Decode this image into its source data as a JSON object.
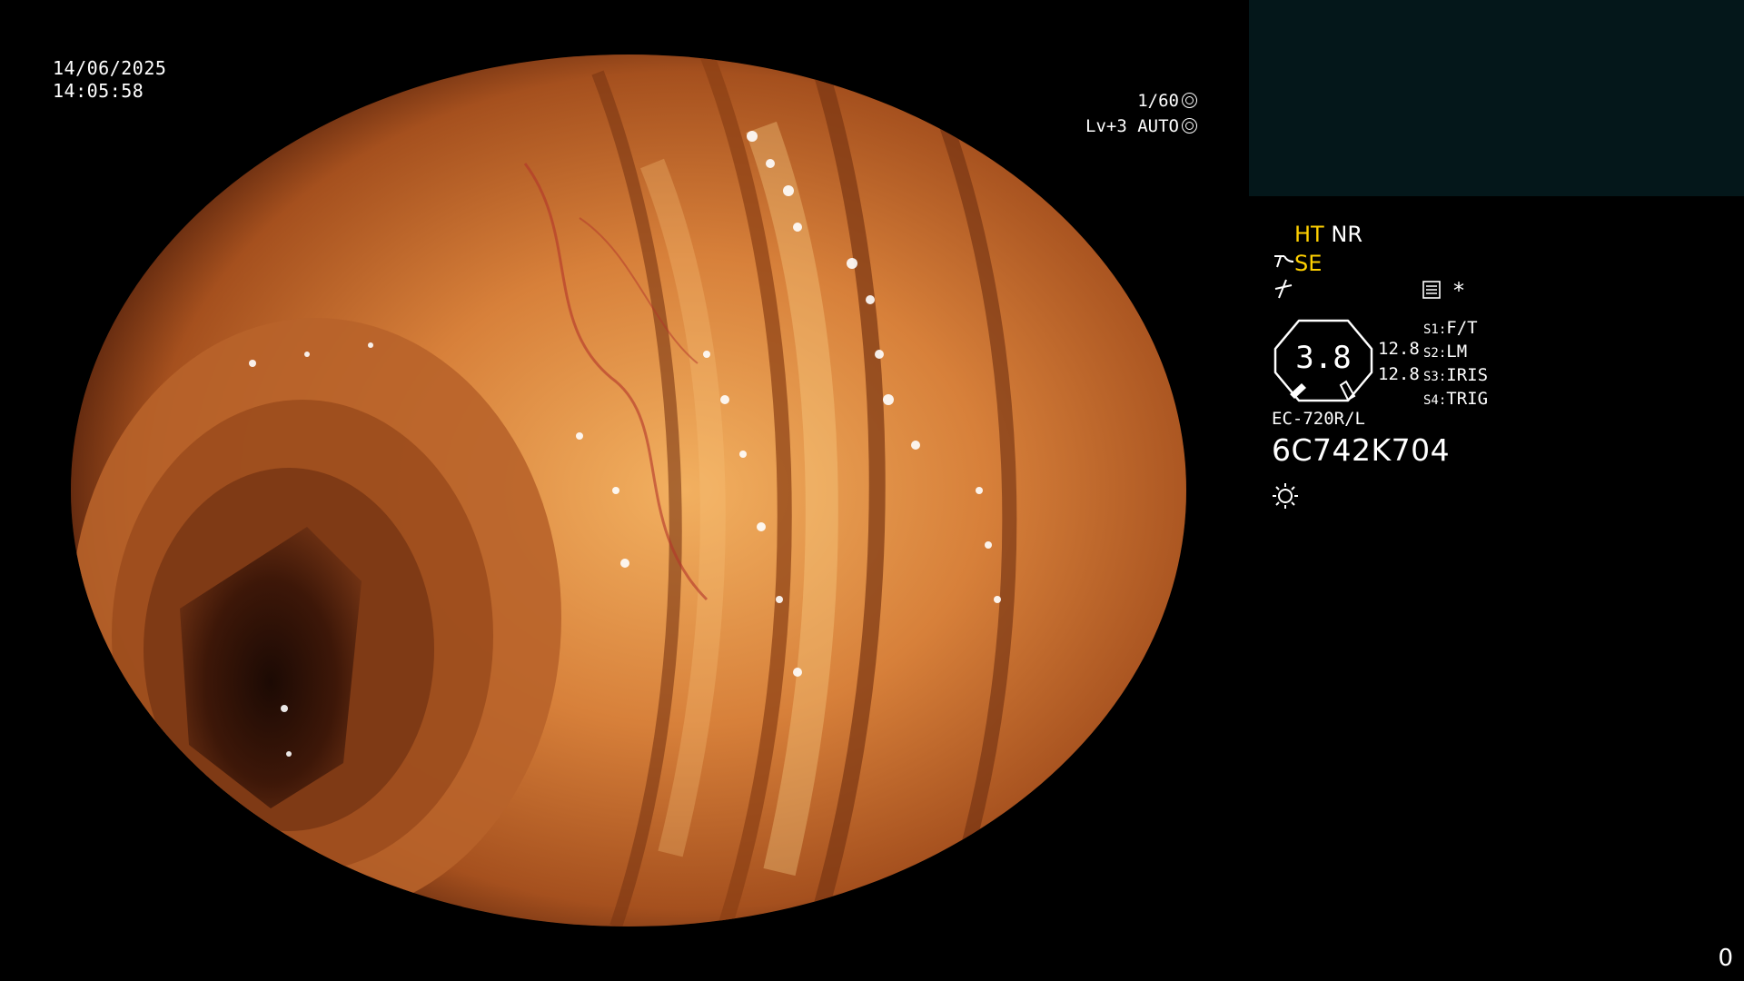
{
  "overlay": {
    "date": "14/06/2025",
    "time": "14:05:58",
    "shutter": "1/60",
    "level": "Lv+3 AUTO"
  },
  "panel": {
    "ht": "HT",
    "nr": "NR",
    "se": "SE",
    "asterisk": "*",
    "gauge_value": "3.8",
    "values": [
      "12.8",
      "12.8"
    ],
    "switches": [
      {
        "key": "S1:",
        "value": "F/T"
      },
      {
        "key": "S2:",
        "value": "LM"
      },
      {
        "key": "S3:",
        "value": "IRIS"
      },
      {
        "key": "S4:",
        "value": "TRIG"
      }
    ],
    "model": "EC-720R/L",
    "serial": "6C742K704"
  },
  "corner": "0",
  "colors": {
    "accent": "#ffd000",
    "thumbnail_bg": "#04171a",
    "mucosa": "#d9823c"
  }
}
